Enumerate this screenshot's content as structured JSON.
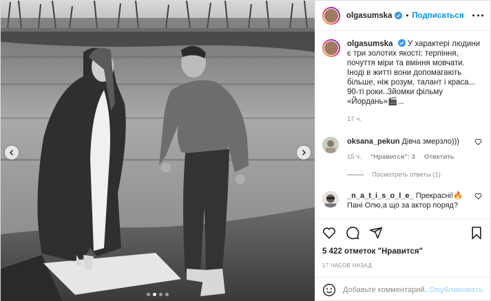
{
  "post": {
    "author": "olgasumska",
    "follow_label": "Подписаться",
    "separator": "•",
    "caption": {
      "author": "olgasumska",
      "text": "У характері людини є три золотих якості: терпіння, почуття міри та вміння мовчати. Іноді в житті вони допомагають більше, ніж розум, талант і краса...",
      "line2": "90-ті роки..Зйомки фільму «Йордань»🎬...",
      "time": "17 ч."
    },
    "comments": [
      {
        "author": "oksana_pekun",
        "text": "Дівча змерзло)))",
        "time": "15 ч.",
        "likes": "\"Нравится\": 3",
        "reply_label": "Ответить",
        "view_replies": "Посмотреть ответы (1)"
      },
      {
        "author": "_n_a_t_i_s_o_l_e_",
        "text": "Прекрасні!🔥Пані Олю,а що за актор поряд?"
      }
    ],
    "likes_text": "5 422 отметок \"Нравится\"",
    "timestamp": "17 часов назад",
    "comment_placeholder": "Добавьте комментарий...",
    "publish_label": "Опубликовать",
    "carousel": {
      "count": 4,
      "active": 2
    }
  },
  "colors": {
    "accent": "#0095f6",
    "secondary_text": "#8e8e8e",
    "publish_disabled": "#b2dffc"
  },
  "icons": [
    "verified-icon",
    "more-icon",
    "heart-icon",
    "comment-icon",
    "share-icon",
    "bookmark-icon",
    "emoji-icon",
    "chevron-left-icon",
    "chevron-right-icon"
  ]
}
